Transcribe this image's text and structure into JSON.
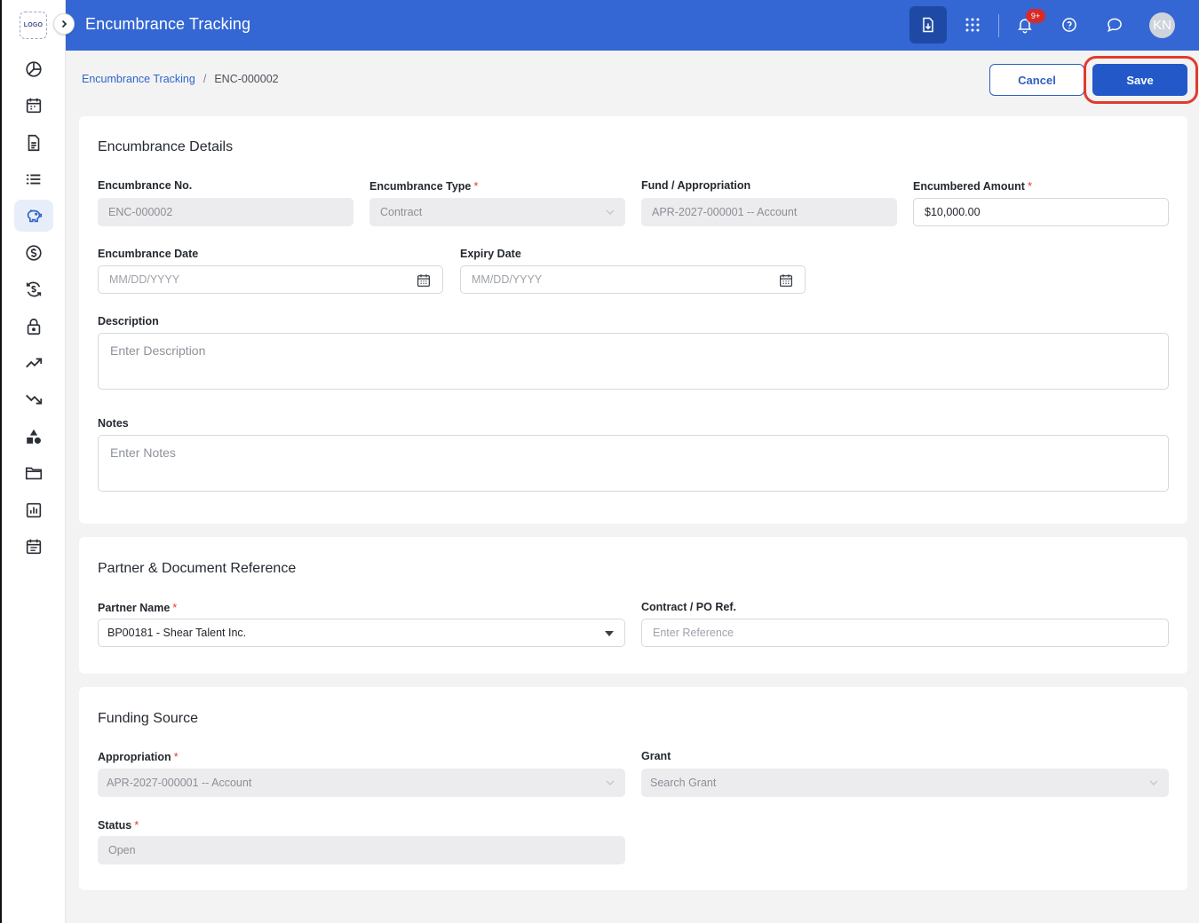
{
  "app": {
    "logo_text": "LOGO",
    "title": "Encumbrance Tracking",
    "notifications_count": "9+",
    "avatar_initials": "KN"
  },
  "sidebar": {
    "items": [
      {
        "icon": "pie-chart-icon"
      },
      {
        "icon": "calendar-icon"
      },
      {
        "icon": "document-icon"
      },
      {
        "icon": "list-icon"
      },
      {
        "icon": "piggy-bank-icon",
        "active": true
      },
      {
        "icon": "dollar-circle-icon"
      },
      {
        "icon": "dollar-refresh-icon"
      },
      {
        "icon": "lock-icon"
      },
      {
        "icon": "trend-up-icon"
      },
      {
        "icon": "trend-down-icon"
      },
      {
        "icon": "shapes-icon"
      },
      {
        "icon": "folder-icon"
      },
      {
        "icon": "bar-report-icon"
      },
      {
        "icon": "calendar-list-icon"
      }
    ]
  },
  "breadcrumb": {
    "parent": "Encumbrance Tracking",
    "separator": "/",
    "current": "ENC-000002"
  },
  "actions": {
    "cancel_label": "Cancel",
    "save_label": "Save"
  },
  "details": {
    "title": "Encumbrance Details",
    "encumbrance_no": {
      "label": "Encumbrance No.",
      "value": "ENC-000002"
    },
    "encumbrance_type": {
      "label": "Encumbrance Type",
      "value": "Contract"
    },
    "fund": {
      "label": "Fund / Appropriation",
      "value": "APR-2027-000001 -- Account"
    },
    "amount": {
      "label": "Encumbered Amount",
      "value": "$10,000.00"
    },
    "encumbrance_date": {
      "label": "Encumbrance Date",
      "placeholder": "MM/DD/YYYY"
    },
    "expiry_date": {
      "label": "Expiry Date",
      "placeholder": "MM/DD/YYYY"
    },
    "description": {
      "label": "Description",
      "placeholder": "Enter Description"
    },
    "notes": {
      "label": "Notes",
      "placeholder": "Enter Notes"
    }
  },
  "partner": {
    "title": "Partner & Document Reference",
    "partner_name": {
      "label": "Partner Name",
      "value": "BP00181 - Shear Talent Inc."
    },
    "contract_ref": {
      "label": "Contract / PO Ref.",
      "placeholder": "Enter Reference"
    }
  },
  "funding": {
    "title": "Funding Source",
    "appropriation": {
      "label": "Appropriation",
      "value": "APR-2027-000001 -- Account"
    },
    "grant": {
      "label": "Grant",
      "placeholder": "Search Grant"
    },
    "status": {
      "label": "Status",
      "value": "Open"
    }
  },
  "required_marker": "*",
  "colors": {
    "header": "#3467d4",
    "primary_button": "#2358c8",
    "highlight_ring": "#e13b2c",
    "required": "#e03b32"
  }
}
